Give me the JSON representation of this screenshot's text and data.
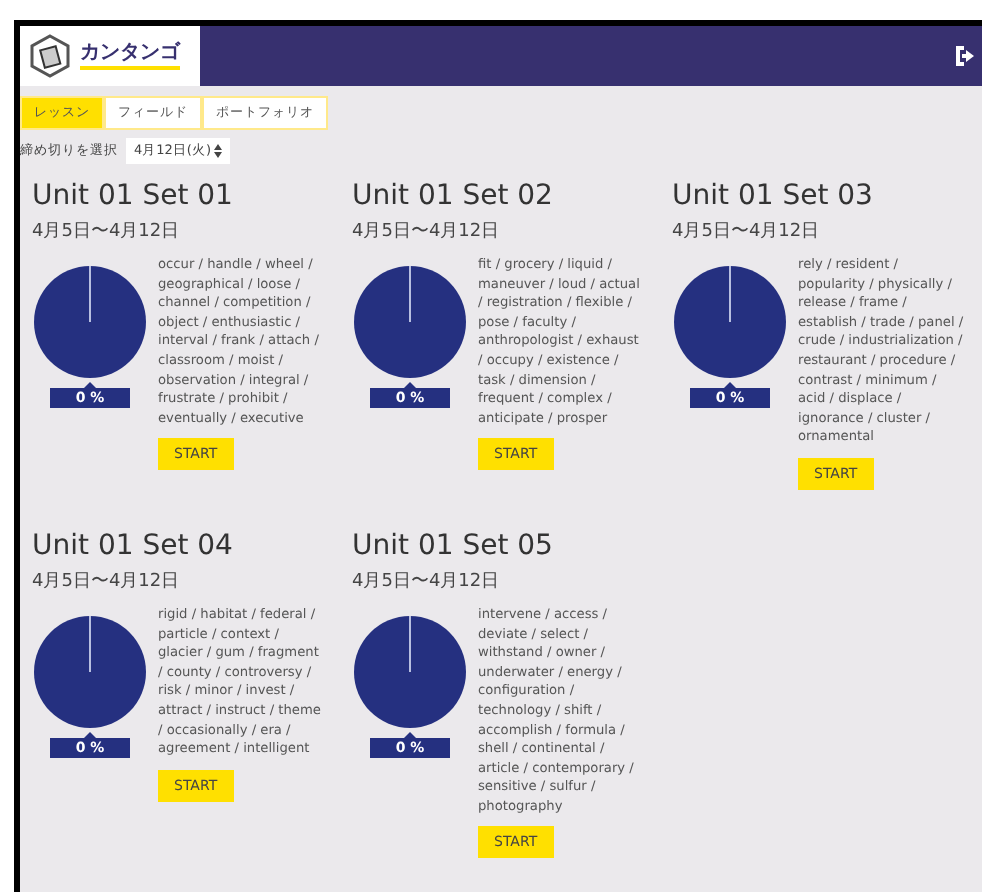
{
  "header": {
    "logo": "カンタンゴ"
  },
  "tabs": [
    {
      "label": "レッスン",
      "selected": true
    },
    {
      "label": "フィールド",
      "selected": false
    },
    {
      "label": "ポートフォリオ",
      "selected": false
    }
  ],
  "deadline": {
    "label": "締め切りを選択",
    "value": "4月12日(火)"
  },
  "sets": [
    {
      "title": "Unit 01 Set 01",
      "dates": "4月5日〜4月12日",
      "percent": "0 %",
      "words": "occur / handle / wheel / geographical / loose / channel / competition / object / enthusiastic / interval / frank / attach / classroom / moist / observation / integral / frustrate / prohibit / eventually / executive",
      "button": "START"
    },
    {
      "title": "Unit 01 Set 02",
      "dates": "4月5日〜4月12日",
      "percent": "0 %",
      "words": "fit / grocery / liquid / maneuver / loud / actual / registration / flexible / pose / faculty / anthropologist / exhaust / occupy / existence / task / dimension / frequent / complex / anticipate / prosper",
      "button": "START"
    },
    {
      "title": "Unit 01 Set 03",
      "dates": "4月5日〜4月12日",
      "percent": "0 %",
      "words": "rely / resident / popularity / physically / release / frame / establish / trade / panel / crude / industrialization / restaurant / procedure / contrast / minimum / acid / displace / ignorance / cluster / ornamental",
      "button": "START"
    },
    {
      "title": "Unit 01 Set 04",
      "dates": "4月5日〜4月12日",
      "percent": "0 %",
      "words": "rigid / habitat / federal / particle / context / glacier / gum / fragment / county / controversy / risk / minor / invest / attract / instruct / theme / occasionally / era / agreement / intelligent",
      "button": "START"
    },
    {
      "title": "Unit 01 Set 05",
      "dates": "4月5日〜4月12日",
      "percent": "0 %",
      "words": "intervene / access / deviate / select / withstand / owner / underwater / energy / configuration / technology / shift / accomplish / formula / shell / continental / article / contemporary / sensitive / sulfur / photography",
      "button": "START"
    }
  ]
}
